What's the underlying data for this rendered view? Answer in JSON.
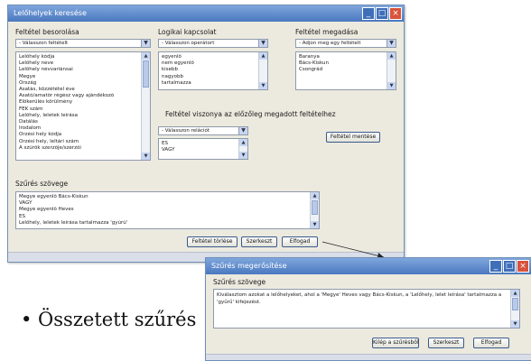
{
  "main_window": {
    "title": "Lelőhelyek keresése",
    "window_controls": [
      "_",
      "□",
      "×"
    ],
    "criteria": {
      "label": "Feltétel besorolása",
      "select_value": "- Válasszon feltételt",
      "items": [
        "Lelőhely kódja",
        "Lelőhely neve",
        "Lelőhely névvariánsai",
        "Megye",
        "Ország",
        "Ásatás, közzététel éve",
        "Ásató/amatőr régész vagy ajándékozó",
        "Előkerülés körülmény",
        "FÉK szám",
        "Lelőhely, leletek leírása",
        "Datálás",
        "Irodalom",
        "Őrzési hely kódja",
        "Őrzési hely, leltári szám",
        "A szűrők szerzője/szerzői"
      ]
    },
    "logic": {
      "label": "Logikai kapcsolat",
      "select_value": "- Válasszon operátort",
      "items": [
        "egyenlő",
        "nem egyenlő",
        "kisebb",
        "nagyobb",
        "tartalmazza"
      ]
    },
    "value": {
      "label": "Feltétel megadása",
      "select_value": "- Adjon meg egy feltételt",
      "items": [
        "Baranya",
        "Bács-Kiskun",
        "Csongrád"
      ]
    },
    "relation": {
      "label": "Feltétel viszonya az előzőleg megadott feltételhez",
      "select_value": "- Válasszon relációt",
      "items": [
        "ÉS",
        "VAGY"
      ]
    },
    "save_condition_button": "Feltétel mentése",
    "filter_text": {
      "label": "Szűrés szövege",
      "lines": [
        "Megye egyenlő Bács-Kiskun",
        "VAGY",
        "Megye egyenlő Heves",
        "ÉS",
        "Lelőhely, leletek leírása tartalmazza 'gyűrű'"
      ]
    },
    "buttons": {
      "delete": "Feltétel törlése",
      "edit": "Szerkeszt",
      "accept": "Elfogad"
    }
  },
  "confirm_window": {
    "title": "Szűrés megerősítése",
    "window_controls": [
      "_",
      "□",
      "×"
    ],
    "label": "Szűrés szövege",
    "text": "Kiválasztom azokat a lelőhelyeket, ahol a 'Megye' Heves vagy Bács-Kiskun, a 'Lelőhely, lelet leírása' tartalmazza a 'gyűrű' kifejezést.",
    "buttons": {
      "back": "Kilép a szűrésből",
      "edit": "Szerkeszt",
      "accept": "Elfogad"
    }
  },
  "bullet": "• Összetett szűrés",
  "colors": {
    "title_gradient_top": "#7fa6dc",
    "title_gradient_bottom": "#4a78c0",
    "window_bg": "#eceadf",
    "close_button": "#d8533b"
  }
}
